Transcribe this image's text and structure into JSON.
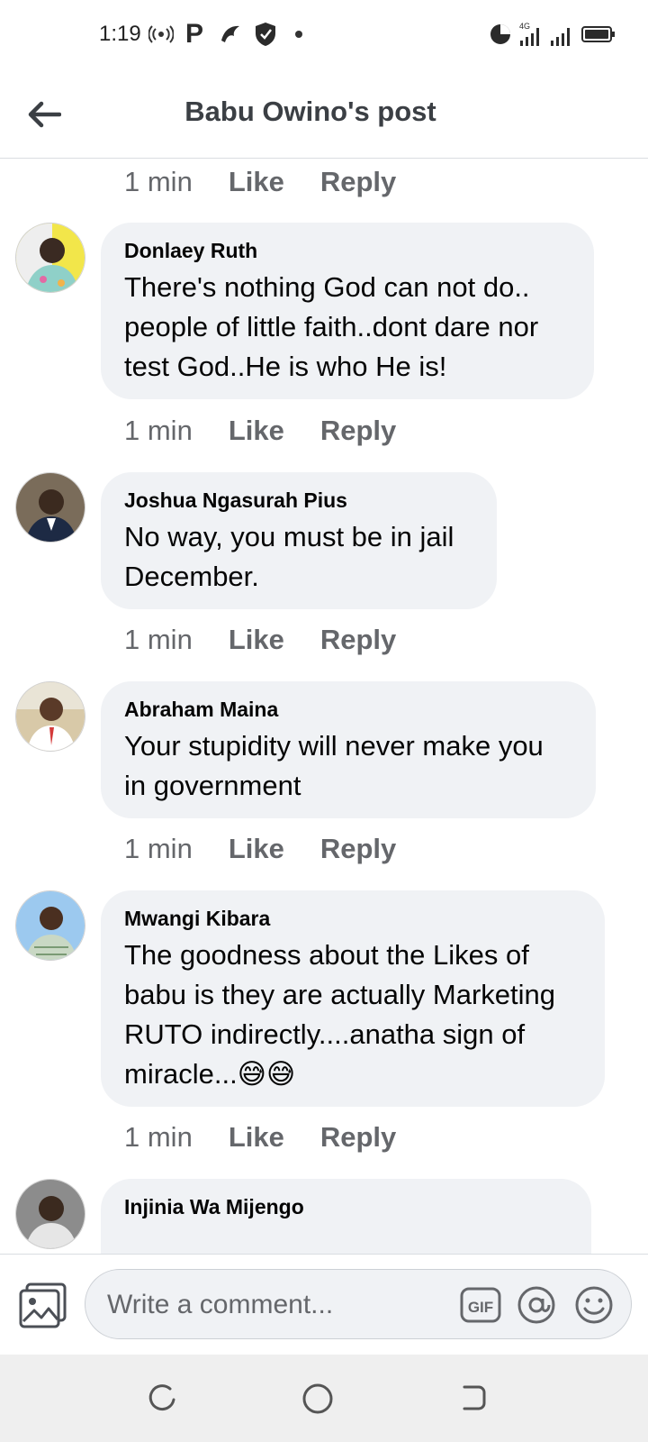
{
  "status_bar": {
    "time": "1:19",
    "network": "4G",
    "icons": [
      "hotspot-icon",
      "p-app-icon",
      "bird-app-icon",
      "shield-icon",
      "dot-icon",
      "data-saver-icon",
      "signal-icon",
      "signal-icon-2",
      "battery-icon"
    ]
  },
  "header": {
    "title": "Babu Owino's post"
  },
  "top_actions": {
    "time": "1 min",
    "like": "Like",
    "reply": "Reply"
  },
  "comments": [
    {
      "author": "Donlaey Ruth",
      "text": "There's nothing God can not do.. people of little faith..dont dare nor test God..He is who He is!",
      "time": "1 min",
      "like": "Like",
      "reply": "Reply"
    },
    {
      "author": "Joshua Ngasurah Pius",
      "text": "No way, you must be in jail December.",
      "time": "1 min",
      "like": "Like",
      "reply": "Reply"
    },
    {
      "author": "Abraham Maina",
      "text": "Your stupidity will never make you in government",
      "time": "1 min",
      "like": "Like",
      "reply": "Reply"
    },
    {
      "author": "Mwangi Kibara",
      "text": "The goodness about the Likes of babu is they are actually Marketing RUTO indirectly....anatha sign of miracle...😅😅",
      "time": "1 min",
      "like": "Like",
      "reply": "Reply"
    },
    {
      "author": "Injinia Wa Mijengo",
      "text": ""
    }
  ],
  "composer": {
    "placeholder": "Write a comment...",
    "gif_label": "GIF"
  },
  "colors": {
    "bubble": "#f0f2f5",
    "secondary_text": "#65676b",
    "title_text": "#3b3f44"
  }
}
